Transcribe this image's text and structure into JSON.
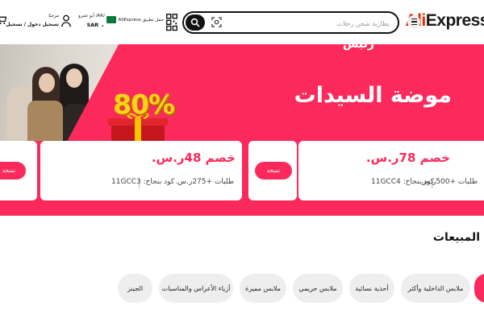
{
  "header": {
    "logo": {
      "part1": "Ali",
      "part2": "Express"
    },
    "search": {
      "placeholder": "بطارية شحن رحلات"
    },
    "app_download": {
      "label": "حمل تطبيق AliExpress"
    },
    "locale": {
      "top": "/AR/ أبو عمرو",
      "currency": "SAR"
    },
    "account": {
      "greeting": "مرحبًا",
      "action": "تسجيل دخول / تسجيل"
    }
  },
  "banner": {
    "title": "موضة السيدات",
    "title_deco": "رئيس",
    "discount_badge": "80%",
    "coupons": [
      {
        "amount": "خصم 78ر.س.",
        "condition": "طلبات +500ر.س.",
        "code": "كود بنجاح: 11GCC4",
        "save_label": "نسخة"
      },
      {
        "amount": "خصم 48ر.س.",
        "condition": "طلبات +275ر.س.",
        "code": "كود بنجاح: 11GCC3",
        "save_label": "نسخة"
      }
    ]
  },
  "best_sellers": {
    "title": "المبيعات",
    "categories": [
      {
        "label": "ملابس الداخلية وأكثر"
      },
      {
        "label": "أحذية نسائية"
      },
      {
        "label": "ملابس حريمي"
      },
      {
        "label": "ملابس مميزة"
      },
      {
        "label": "أزياء الأعراس والمناسبات"
      },
      {
        "label": "الجينز"
      }
    ]
  },
  "colors": {
    "brand": "#fc2a5c",
    "logo_red": "#e62e04",
    "discount_yellow": "#ffd21a"
  }
}
